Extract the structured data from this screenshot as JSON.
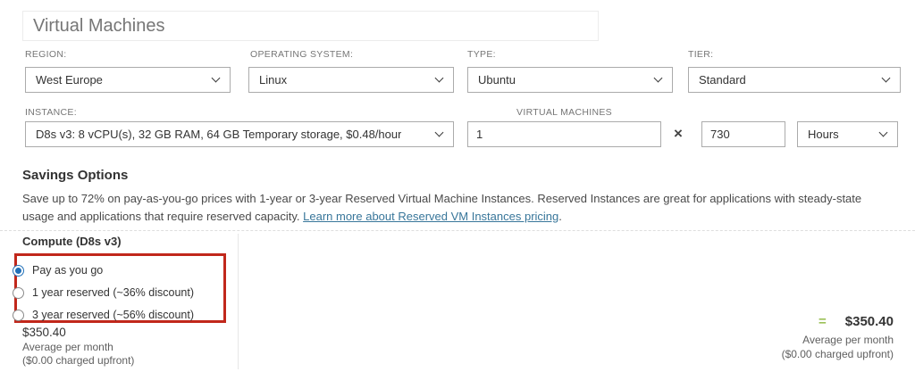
{
  "title": {
    "value": "Virtual Machines"
  },
  "filters": {
    "region": {
      "label": "REGION:",
      "value": "West Europe"
    },
    "os": {
      "label": "OPERATING SYSTEM:",
      "value": "Linux"
    },
    "type": {
      "label": "TYPE:",
      "value": "Ubuntu"
    },
    "tier": {
      "label": "TIER:",
      "value": "Standard"
    }
  },
  "instance_row": {
    "instance": {
      "label": "INSTANCE:",
      "value": "D8s v3: 8 vCPU(s), 32 GB RAM, 64 GB Temporary storage, $0.48/hour"
    },
    "vm_count": {
      "label": "VIRTUAL MACHINES",
      "value": "1"
    },
    "multiply_symbol": "×",
    "hours_value": "730",
    "hours_unit": "Hours"
  },
  "savings": {
    "heading": "Savings Options",
    "description_before_link": "Save up to 72% on pay-as-you-go prices with 1-year or 3-year Reserved Virtual Machine Instances. Reserved Instances are great for applications with steady-state usage and applications that require reserved capacity. ",
    "link_text": "Learn more about Reserved VM Instances pricing",
    "description_after_link": "."
  },
  "compute": {
    "heading": "Compute (D8s v3)",
    "options": [
      {
        "label": "Pay as you go",
        "selected": true
      },
      {
        "label": "1 year reserved (~36% discount)",
        "selected": false
      },
      {
        "label": "3 year reserved (~56% discount)",
        "selected": false
      }
    ],
    "price": "$350.40",
    "price_caption": "Average per month",
    "price_note": "($0.00 charged upfront)"
  },
  "total": {
    "equals_symbol": "=",
    "price": "$350.40",
    "caption": "Average per month",
    "note": "($0.00 charged upfront)"
  },
  "colors": {
    "accent_link": "#38769a",
    "highlight_red": "#c1271b",
    "radio_selected_blue": "#2170b8",
    "equals_green": "#9cc159"
  }
}
